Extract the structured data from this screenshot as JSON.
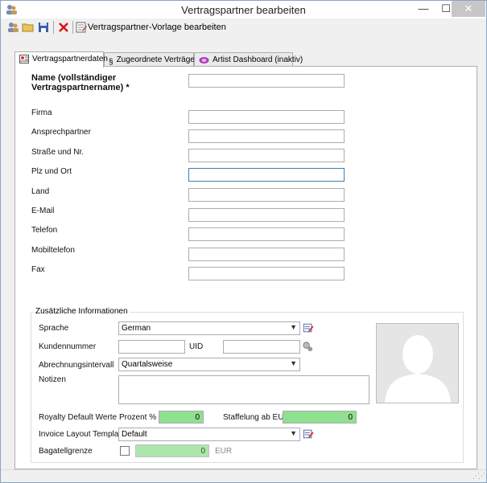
{
  "window": {
    "title": "Vertragspartner bearbeiten",
    "minimize": "—",
    "maximize": "☐",
    "close": "✕"
  },
  "toolbar": {
    "template_label": "Vertragspartner-Vorlage bearbeiten"
  },
  "tabs": [
    {
      "label": "Vertragspartnerdaten",
      "active": true
    },
    {
      "label": "Zugeordnete Verträge",
      "icon": "§"
    },
    {
      "label": "Artist Dashboard (inaktiv)"
    }
  ],
  "fields": {
    "name_label": "Name (vollständiger Vertragspartnername) *",
    "firma_label": "Firma",
    "ansprechpartner_label": "Ansprechpartner",
    "strasse_label": "Straße und Nr.",
    "plz_label": "Plz und Ort",
    "land_label": "Land",
    "email_label": "E-Mail",
    "telefon_label": "Telefon",
    "mobil_label": "Mobiltelefon",
    "fax_label": "Fax"
  },
  "extra": {
    "group_title": "Zusätzliche Informationen",
    "sprache_label": "Sprache",
    "sprache_value": "German",
    "kundennummer_label": "Kundennummer",
    "uid_label": "UID",
    "abrechnung_label": "Abrechnungsintervall",
    "abrechnung_value": "Quartalsweise",
    "notizen_label": "Notizen",
    "royalty_label": "Royalty Default Werte",
    "prozent_label": "Prozent %",
    "prozent_value": "0",
    "staffelung_label": "Staffelung ab EUR",
    "staffelung_value": "0",
    "invoice_label": "Invoice Layout Template",
    "invoice_value": "Default",
    "bagatell_label": "Bagatellgrenze",
    "bagatell_value": "0",
    "bagatell_unit": "EUR"
  },
  "colors": {
    "accent": "#3c7fb1",
    "field_green": "#8fe08f"
  }
}
